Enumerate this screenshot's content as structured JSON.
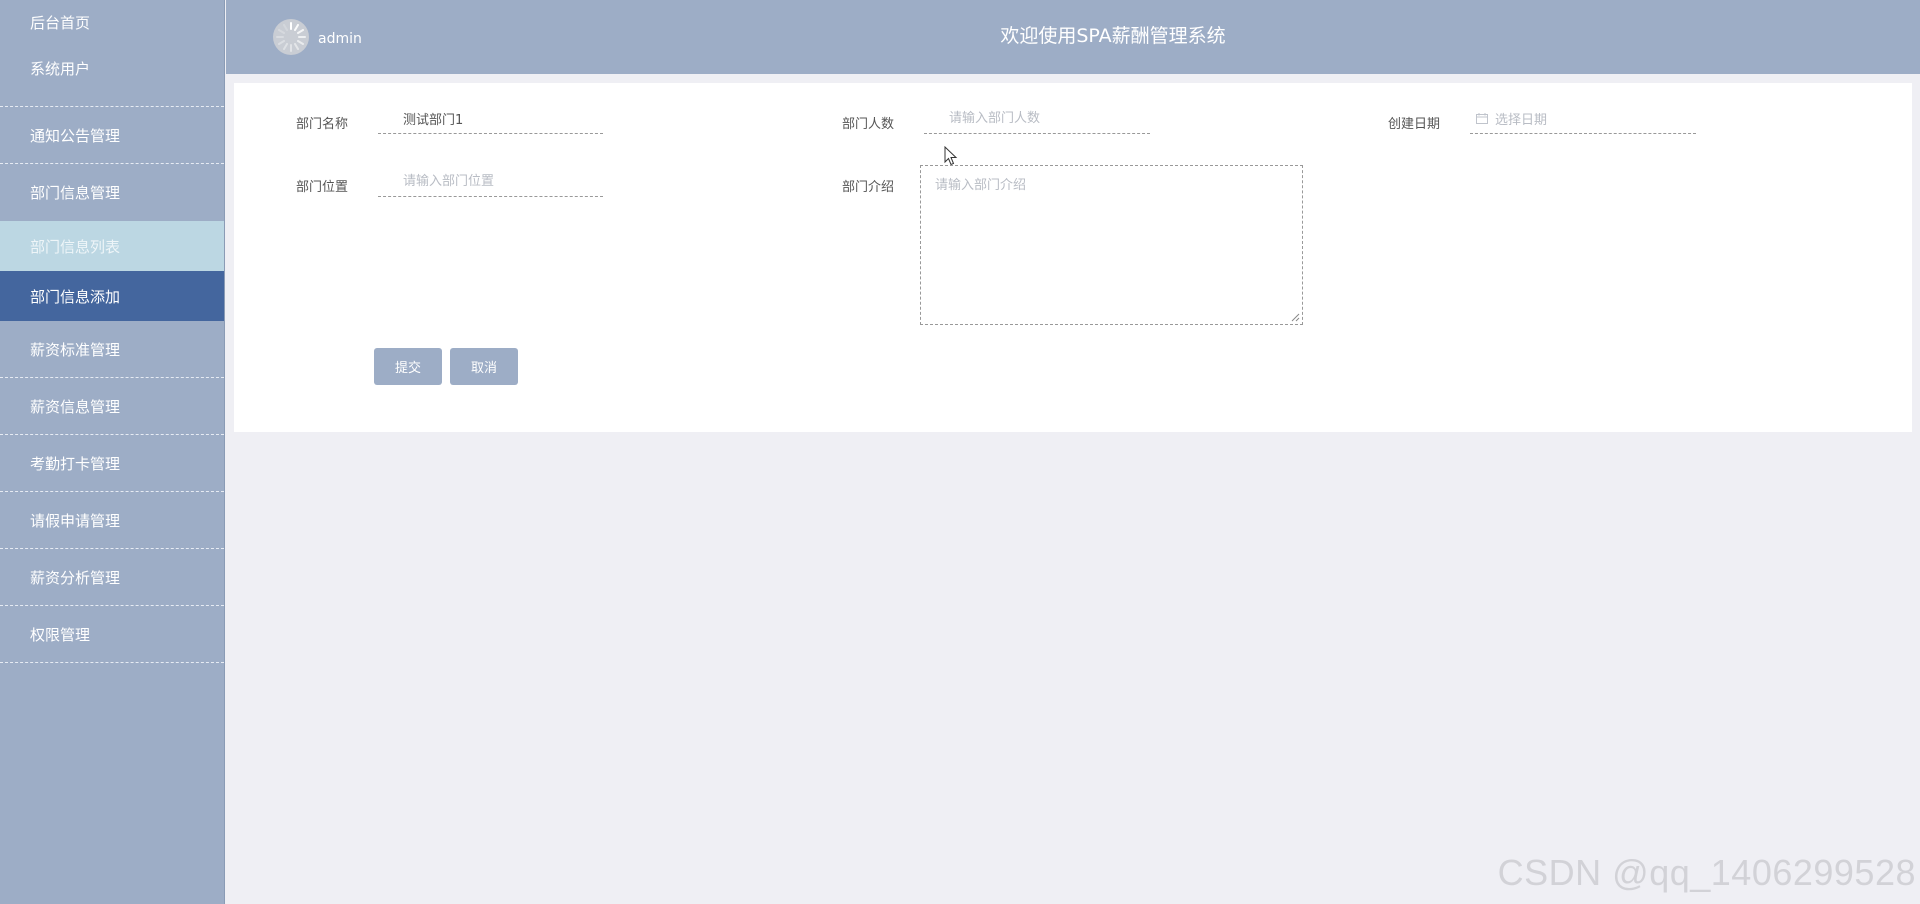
{
  "sidebar": {
    "items": [
      {
        "label": "后台首页"
      },
      {
        "label": "系统用户"
      },
      {
        "label": "通知公告管理"
      },
      {
        "label": "部门信息管理"
      },
      {
        "label": "部门信息列表"
      },
      {
        "label": "部门信息添加"
      },
      {
        "label": "薪资标准管理"
      },
      {
        "label": "薪资信息管理"
      },
      {
        "label": "考勤打卡管理"
      },
      {
        "label": "请假申请管理"
      },
      {
        "label": "薪资分析管理"
      },
      {
        "label": "权限管理"
      }
    ]
  },
  "header": {
    "username": "admin",
    "title": "欢迎使用SPA薪酬管理系统"
  },
  "form": {
    "dept_name": {
      "label": "部门名称",
      "value": "测试部门1"
    },
    "dept_count": {
      "label": "部门人数",
      "placeholder": "请输入部门人数"
    },
    "created_date": {
      "label": "创建日期",
      "placeholder": "选择日期"
    },
    "dept_location": {
      "label": "部门位置",
      "placeholder": "请输入部门位置"
    },
    "dept_intro": {
      "label": "部门介绍",
      "placeholder": "请输入部门介绍"
    },
    "submit_label": "提交",
    "cancel_label": "取消"
  },
  "watermark": "CSDN @qq_1406299528",
  "colors": {
    "sidebar": "#9dadc6",
    "active_item": "#44669e",
    "sub_item": "#bcd7e3",
    "content_bg": "#efeff4",
    "button": "#9dadc6"
  },
  "icons": {
    "avatar": "loading-spinner-icon",
    "date": "calendar-icon",
    "cursor": "mouse-pointer-icon"
  }
}
